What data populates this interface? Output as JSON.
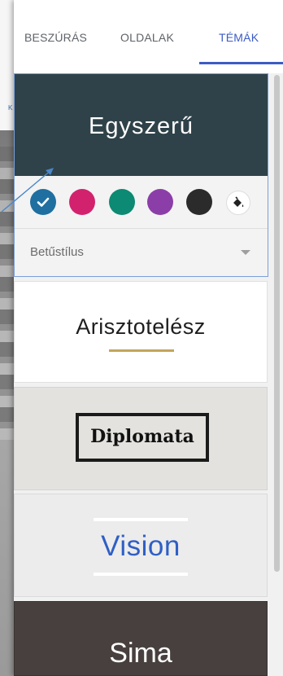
{
  "tabs": [
    {
      "label": "BESZÚRÁS",
      "active": false
    },
    {
      "label": "OLDALAK",
      "active": false
    },
    {
      "label": "TÉMÁK",
      "active": true
    }
  ],
  "selected_theme": {
    "name_plain": "Egyszer",
    "name_bold": "ű",
    "colors": [
      "#1f6fa0",
      "#d2226e",
      "#0c8a73",
      "#8b3ea8",
      "#2b2b2b"
    ],
    "selected_color_index": 0,
    "font_style_label": "Betűstílus",
    "icons": {
      "check": "check-icon",
      "paint": "paint-bucket-icon",
      "dropdown": "caret-down-icon"
    }
  },
  "themes": [
    {
      "name": "Arisztotelész"
    },
    {
      "name": "Diplomata"
    },
    {
      "name": "Vision"
    },
    {
      "name": "Sima"
    }
  ],
  "accent_color": "#3c5bc4"
}
